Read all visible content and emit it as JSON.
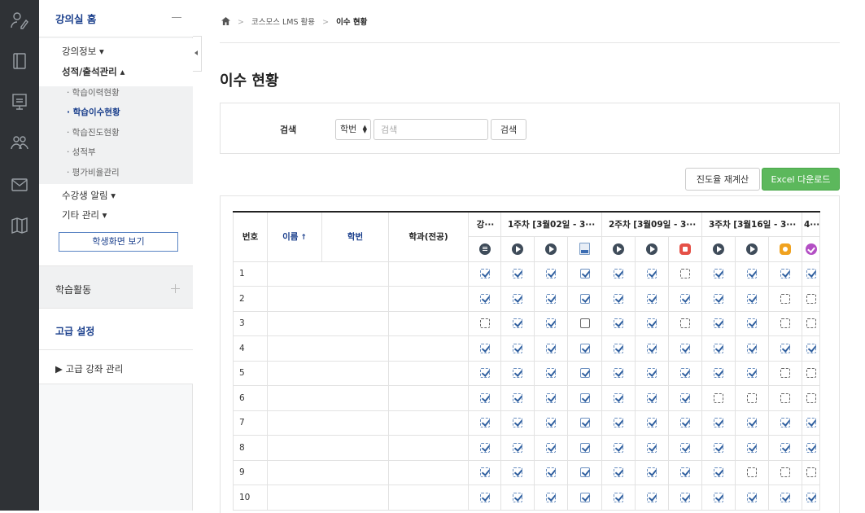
{
  "rail": {
    "icons": [
      "user-edit-icon",
      "book-icon",
      "presentation-icon",
      "group-icon",
      "mail-icon",
      "map-icon"
    ]
  },
  "sidebar": {
    "home": "강의실 홈",
    "course_info": "강의정보 ▾",
    "grades": "성적/출석관리 ▴",
    "sub_items": [
      "· 학습이력현황",
      "· 학습이수현황",
      "· 학습진도현황",
      "· 성적부",
      "· 평가비율관리"
    ],
    "active_sub": 1,
    "notice": "수강생 알림 ▾",
    "etc": "기타 관리 ▾",
    "student_view": "학생화면 보기",
    "learning": "학습활동",
    "advanced": "고급 설정",
    "advanced_manage": "▶  고급 강좌 관리"
  },
  "breadcrumb": {
    "items": [
      "코스모스 LMS 활용",
      "이수 현황"
    ]
  },
  "page": {
    "title": "이수 현황"
  },
  "search": {
    "label": "검색",
    "select_value": "학번",
    "placeholder": "검색",
    "button": "검색"
  },
  "actions": {
    "recalc": "진도율 재계산",
    "excel": "Excel 다운로드"
  },
  "colors": {
    "brand": "#1a3f8c",
    "excel": "#5cb85c",
    "rail": "#2f3236"
  },
  "table": {
    "headers": {
      "no": "번호",
      "name": "이름",
      "name_sort": "↑",
      "id": "학번",
      "dept": "학과(전공)",
      "col_ellipsis": "강···",
      "week1": "1주차 [3월02일 - 3···",
      "week2": "2주차 [3월09일 - 3···",
      "week3": "3주차 [3월16일 - 3···",
      "week4": "4···"
    },
    "activity_icons": [
      "list-icon",
      "play-icon",
      "play-icon",
      "doc-icon",
      "play-icon",
      "play-icon",
      "red-assignment-icon",
      "play-icon",
      "play-icon",
      "orange-forum-icon",
      "purple-check-icon"
    ],
    "rows": [
      {
        "no": "1",
        "cells": [
          1,
          1,
          1,
          2,
          1,
          1,
          0,
          1,
          1,
          1,
          1
        ]
      },
      {
        "no": "2",
        "cells": [
          1,
          1,
          1,
          2,
          1,
          1,
          1,
          1,
          1,
          0,
          0
        ]
      },
      {
        "no": "3",
        "cells": [
          0,
          1,
          1,
          3,
          1,
          1,
          0,
          1,
          1,
          0,
          0
        ]
      },
      {
        "no": "4",
        "cells": [
          1,
          1,
          1,
          2,
          1,
          1,
          1,
          1,
          1,
          1,
          1
        ]
      },
      {
        "no": "5",
        "cells": [
          1,
          1,
          1,
          2,
          1,
          1,
          1,
          1,
          1,
          0,
          0
        ]
      },
      {
        "no": "6",
        "cells": [
          1,
          1,
          1,
          2,
          1,
          1,
          1,
          0,
          0,
          0,
          0
        ]
      },
      {
        "no": "7",
        "cells": [
          1,
          1,
          1,
          2,
          1,
          1,
          1,
          1,
          1,
          1,
          1
        ]
      },
      {
        "no": "8",
        "cells": [
          1,
          1,
          1,
          2,
          1,
          1,
          1,
          1,
          1,
          1,
          1
        ]
      },
      {
        "no": "9",
        "cells": [
          1,
          1,
          1,
          2,
          1,
          1,
          1,
          1,
          0,
          0,
          0
        ]
      },
      {
        "no": "10",
        "cells": [
          1,
          1,
          1,
          2,
          1,
          1,
          1,
          1,
          1,
          1,
          1
        ]
      }
    ]
  }
}
